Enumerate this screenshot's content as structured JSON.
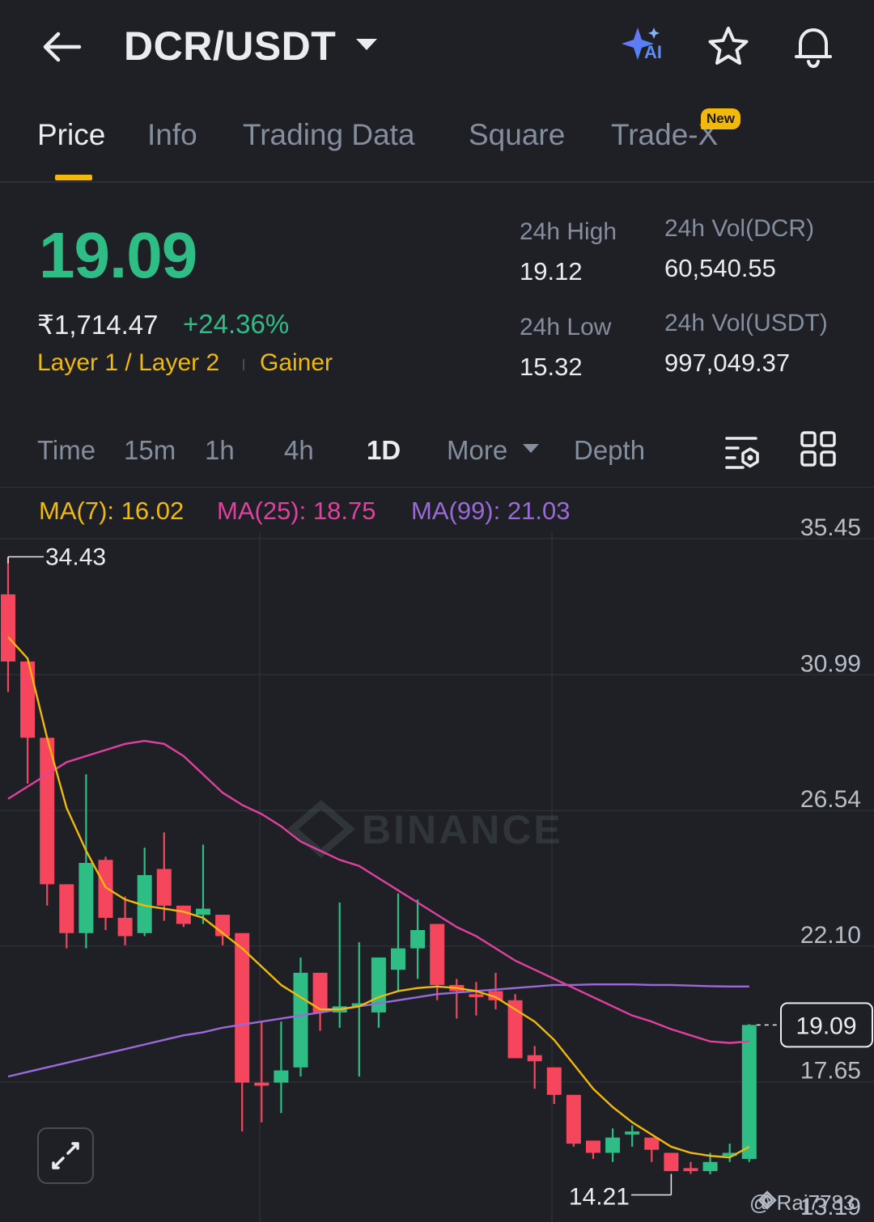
{
  "header": {
    "back_icon": "arrow-left-icon",
    "title": "DCR/USDT",
    "caret_icon": "caret-down-icon",
    "actions": [
      "ai-sparkle-icon",
      "star-icon",
      "bell-icon"
    ],
    "ai_badge": "AI"
  },
  "tabs": [
    {
      "label": "Price",
      "active": true
    },
    {
      "label": "Info",
      "active": false
    },
    {
      "label": "Trading Data",
      "active": false
    },
    {
      "label": "Square",
      "active": false
    },
    {
      "label": "Trade-X",
      "active": false,
      "badge": "New"
    }
  ],
  "price": {
    "last": "19.09",
    "inr": "₹1,714.47",
    "change": "+24.36%",
    "tags": [
      "Layer 1 / Layer 2",
      "Gainer"
    ]
  },
  "stats": {
    "high_label": "24h High",
    "high": "19.12",
    "low_label": "24h Low",
    "low": "15.32",
    "vol_base_label": "24h Vol(DCR)",
    "vol_base": "60,540.55",
    "vol_quote_label": "24h Vol(USDT)",
    "vol_quote": "997,049.37"
  },
  "intervals": {
    "items": [
      "Time",
      "15m",
      "1h",
      "4h",
      "1D"
    ],
    "active": "1D",
    "more": "More",
    "depth": "Depth",
    "icons": [
      "chart-settings-icon",
      "grid-layout-icon"
    ]
  },
  "ma": {
    "ma7": "MA(7): 16.02",
    "ma25": "MA(25): 18.75",
    "ma99": "MA(99): 21.03"
  },
  "colors": {
    "up": "#2ebd85",
    "down": "#f6465d",
    "ma7": "#f0b90b",
    "ma25": "#e040a0",
    "ma99": "#9b6ad8",
    "accent": "#f0b90b",
    "background": "#1e2026"
  },
  "chart_data": {
    "type": "candlestick",
    "y_axis_ticks": [
      "35.45",
      "30.99",
      "26.54",
      "22.10",
      "17.65",
      "13.19"
    ],
    "ylim": [
      13.19,
      35.45
    ],
    "high_marker": "34.43",
    "low_marker": "14.21",
    "last_price_label": "19.09",
    "watermark": "BINANCE",
    "candles": [
      {
        "o": 33.2,
        "h": 34.43,
        "l": 30.0,
        "c": 31.0
      },
      {
        "o": 31.0,
        "h": 31.0,
        "l": 27.0,
        "c": 28.5
      },
      {
        "o": 28.5,
        "h": 28.5,
        "l": 23.0,
        "c": 23.7
      },
      {
        "o": 23.7,
        "h": 23.7,
        "l": 21.6,
        "c": 22.1
      },
      {
        "o": 22.1,
        "h": 27.3,
        "l": 21.6,
        "c": 24.4
      },
      {
        "o": 24.5,
        "h": 24.6,
        "l": 22.2,
        "c": 22.6
      },
      {
        "o": 22.6,
        "h": 23.3,
        "l": 21.7,
        "c": 22.0
      },
      {
        "o": 22.1,
        "h": 24.9,
        "l": 22.0,
        "c": 24.0
      },
      {
        "o": 24.2,
        "h": 25.4,
        "l": 22.5,
        "c": 23.0
      },
      {
        "o": 23.0,
        "h": 23.0,
        "l": 22.3,
        "c": 22.4
      },
      {
        "o": 22.7,
        "h": 25.0,
        "l": 22.4,
        "c": 22.9
      },
      {
        "o": 22.7,
        "h": 22.7,
        "l": 21.7,
        "c": 22.0
      },
      {
        "o": 22.1,
        "h": 22.1,
        "l": 15.6,
        "c": 17.2
      },
      {
        "o": 17.2,
        "h": 19.2,
        "l": 15.9,
        "c": 17.1
      },
      {
        "o": 17.2,
        "h": 19.2,
        "l": 16.2,
        "c": 17.6
      },
      {
        "o": 17.7,
        "h": 21.3,
        "l": 17.4,
        "c": 20.8
      },
      {
        "o": 20.8,
        "h": 20.8,
        "l": 18.9,
        "c": 19.5
      },
      {
        "o": 19.5,
        "h": 23.1,
        "l": 19.0,
        "c": 19.7
      },
      {
        "o": 19.7,
        "h": 21.8,
        "l": 17.4,
        "c": 19.8
      },
      {
        "o": 19.5,
        "h": 21.0,
        "l": 19.0,
        "c": 21.3
      },
      {
        "o": 20.9,
        "h": 23.4,
        "l": 20.2,
        "c": 21.6
      },
      {
        "o": 21.6,
        "h": 23.2,
        "l": 20.6,
        "c": 22.2
      },
      {
        "o": 22.4,
        "h": 22.4,
        "l": 19.9,
        "c": 20.4
      },
      {
        "o": 20.4,
        "h": 20.6,
        "l": 19.3,
        "c": 20.2
      },
      {
        "o": 20.1,
        "h": 20.5,
        "l": 19.4,
        "c": 20.0
      },
      {
        "o": 20.2,
        "h": 20.8,
        "l": 19.6,
        "c": 19.9
      },
      {
        "o": 19.9,
        "h": 20.1,
        "l": 18.6,
        "c": 18.0
      },
      {
        "o": 18.1,
        "h": 18.4,
        "l": 17.0,
        "c": 17.9
      },
      {
        "o": 17.7,
        "h": 17.7,
        "l": 16.5,
        "c": 16.8
      },
      {
        "o": 16.8,
        "h": 16.8,
        "l": 15.1,
        "c": 15.2
      },
      {
        "o": 15.3,
        "h": 15.3,
        "l": 14.7,
        "c": 14.9
      },
      {
        "o": 14.9,
        "h": 15.7,
        "l": 14.6,
        "c": 15.4
      },
      {
        "o": 15.5,
        "h": 15.8,
        "l": 15.1,
        "c": 15.6
      },
      {
        "o": 15.4,
        "h": 15.4,
        "l": 14.6,
        "c": 15.0
      },
      {
        "o": 14.9,
        "h": 14.9,
        "l": 14.3,
        "c": 14.3
      },
      {
        "o": 14.4,
        "h": 14.6,
        "l": 14.21,
        "c": 14.3
      },
      {
        "o": 14.3,
        "h": 14.9,
        "l": 14.2,
        "c": 14.6
      },
      {
        "o": 14.8,
        "h": 15.2,
        "l": 14.6,
        "c": 14.9
      },
      {
        "o": 14.7,
        "h": 19.12,
        "l": 14.6,
        "c": 19.09
      }
    ],
    "ma7": [
      31.8,
      31.1,
      28.5,
      26.2,
      24.8,
      23.6,
      23.2,
      23.0,
      22.9,
      22.8,
      22.6,
      22.1,
      21.6,
      21.0,
      20.4,
      20.0,
      19.6,
      19.6,
      19.7,
      20.0,
      20.2,
      20.3,
      20.35,
      20.3,
      20.2,
      20.0,
      19.6,
      19.2,
      18.6,
      17.8,
      17.0,
      16.4,
      15.9,
      15.5,
      15.1,
      14.9,
      14.8,
      14.75,
      15.1
    ],
    "ma25": [
      26.5,
      26.9,
      27.3,
      27.7,
      27.9,
      28.1,
      28.3,
      28.4,
      28.3,
      27.9,
      27.3,
      26.7,
      26.3,
      26.0,
      25.6,
      25.1,
      24.8,
      24.5,
      24.3,
      23.9,
      23.5,
      23.1,
      22.7,
      22.3,
      22.0,
      21.6,
      21.2,
      20.9,
      20.6,
      20.3,
      20.0,
      19.7,
      19.4,
      19.2,
      18.95,
      18.75,
      18.55,
      18.5,
      18.55
    ],
    "ma99": [
      17.4,
      17.55,
      17.7,
      17.85,
      18.0,
      18.15,
      18.3,
      18.45,
      18.6,
      18.75,
      18.85,
      19.0,
      19.1,
      19.2,
      19.3,
      19.4,
      19.5,
      19.6,
      19.7,
      19.8,
      19.9,
      20.0,
      20.1,
      20.15,
      20.2,
      20.25,
      20.3,
      20.35,
      20.4,
      20.4,
      20.42,
      20.42,
      20.42,
      20.4,
      20.4,
      20.38,
      20.36,
      20.35,
      20.35
    ]
  },
  "watermark_user": "@ Raj7783"
}
